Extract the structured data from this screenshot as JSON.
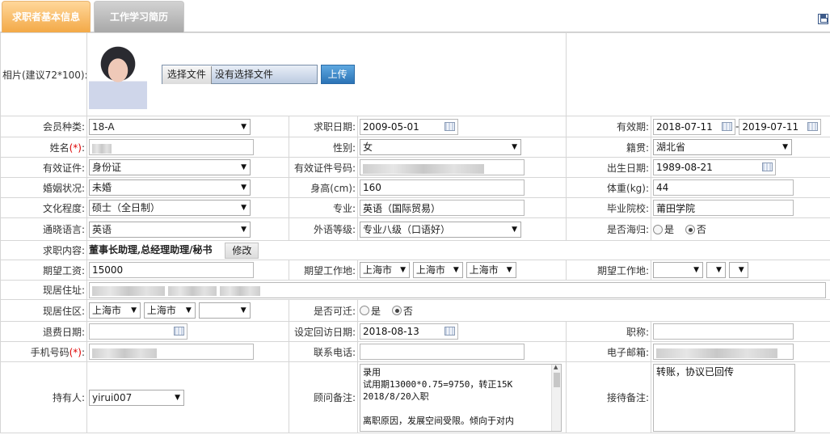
{
  "tabs": {
    "active": "求职者基本信息",
    "other": "工作学习简历"
  },
  "photo": {
    "label": "相片(建议72*100):",
    "file_button": "选择文件",
    "file_status": "没有选择文件",
    "upload_button": "上传"
  },
  "fields": {
    "member_type": {
      "label": "会员种类:",
      "value": "18-A"
    },
    "job_date": {
      "label": "求职日期:",
      "value": "2009-05-01"
    },
    "valid_period": {
      "label": "有效期:",
      "start": "2018-07-11",
      "sep": "-",
      "end": "2019-07-11"
    },
    "name": {
      "label": "姓名",
      "req": "(*)",
      "colon": ":"
    },
    "gender": {
      "label": "性别:",
      "value": "女"
    },
    "native_place": {
      "label": "籍贯:",
      "value": "湖北省"
    },
    "id_type": {
      "label": "有效证件:",
      "value": "身份证"
    },
    "id_number": {
      "label": "有效证件号码:"
    },
    "birth_date": {
      "label": "出生日期:",
      "value": "1989-08-21"
    },
    "marital": {
      "label": "婚姻状况:",
      "value": "未婚"
    },
    "height": {
      "label": "身高(cm):",
      "value": "160"
    },
    "weight": {
      "label": "体重(kg):",
      "value": "44"
    },
    "education": {
      "label": "文化程度:",
      "value": "硕士（全日制）"
    },
    "major": {
      "label": "专业:",
      "value": "英语（国际贸易）"
    },
    "school": {
      "label": "毕业院校:",
      "value": "莆田学院"
    },
    "language": {
      "label": "通晓语言:",
      "value": "英语"
    },
    "language_level": {
      "label": "外语等级:",
      "value": "专业八级（口语好）"
    },
    "returnee": {
      "label": "是否海归:",
      "yes": "是",
      "no": "否"
    },
    "job_content": {
      "label": "求职内容:",
      "value": "董事长助理,总经理助理/秘书",
      "edit_button": "修改"
    },
    "salary": {
      "label": "期望工资:",
      "value": "15000"
    },
    "work_place1": {
      "label": "期望工作地:",
      "v1": "上海市",
      "v2": "上海市",
      "v3": "上海市"
    },
    "work_place2": {
      "label": "期望工作地:"
    },
    "address": {
      "label": "现居住址:"
    },
    "district": {
      "label": "现居住区:",
      "v1": "上海市",
      "v2": "上海市"
    },
    "relocate": {
      "label": "是否可迁:",
      "yes": "是",
      "no": "否"
    },
    "refund_date": {
      "label": "退费日期:"
    },
    "visit_date": {
      "label": "设定回访日期:",
      "value": "2018-08-13"
    },
    "title": {
      "label": "职称:"
    },
    "mobile": {
      "label": "手机号码",
      "req": "(*)",
      "colon": ":"
    },
    "phone": {
      "label": "联系电话:"
    },
    "email": {
      "label": "电子邮箱:"
    },
    "holder": {
      "label": "持有人:",
      "value": "yirui007"
    },
    "consultant_note": {
      "label": "顾问备注:",
      "value": "录用\n试用期13000*0.75=9750，转正15K\n2018/8/20入职\n\n离职原因，发展空间受限。倾向于对内"
    },
    "reception_note": {
      "label": "接待备注:",
      "value": "转账，协议已回传"
    }
  }
}
